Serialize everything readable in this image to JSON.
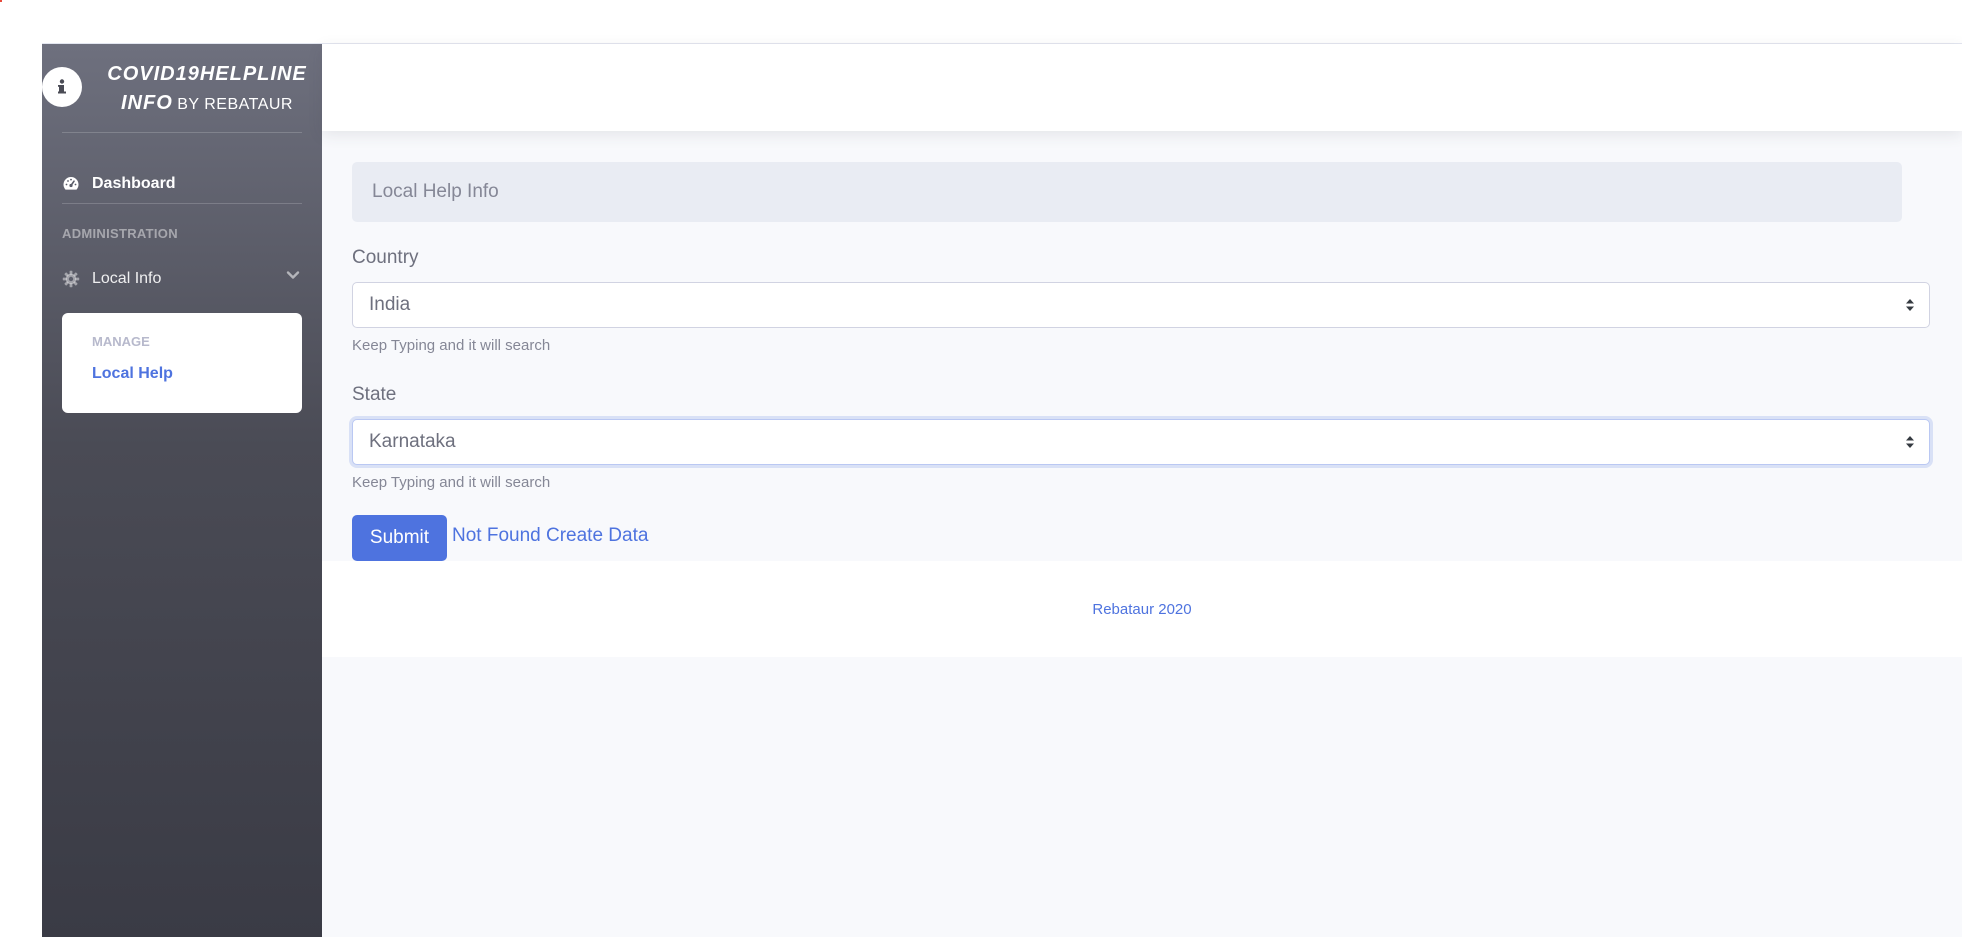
{
  "sidebar": {
    "brand": {
      "icon": "info-icon",
      "title_line1": "COVID19HELPLINE",
      "title_line2": "INFO",
      "subtitle": "BY REBATAUR"
    },
    "dashboard": {
      "icon": "tachometer-icon",
      "label": "Dashboard"
    },
    "section_heading": "ADMINISTRATION",
    "local_info": {
      "icon": "gear-icon",
      "label": "Local Info",
      "expanded": true
    },
    "submenu": {
      "heading": "MANAGE",
      "items": [
        {
          "label": "Local Help",
          "active": true
        }
      ]
    }
  },
  "main": {
    "title": "Local Help Info",
    "country": {
      "label": "Country",
      "selected": "India",
      "help": "Keep Typing and it will search"
    },
    "state": {
      "label": "State",
      "selected": "Karnataka",
      "help": "Keep Typing and it will search"
    },
    "submit_label": "Submit",
    "create_link": "Not Found Create Data",
    "footer": "Rebataur 2020"
  },
  "colors": {
    "primary": "#4e73df",
    "sidebar_top": "#6e707e",
    "sidebar_bottom": "#3a3b45",
    "body_bg": "#f8f9fc",
    "title_bg": "#e9ecf3"
  }
}
